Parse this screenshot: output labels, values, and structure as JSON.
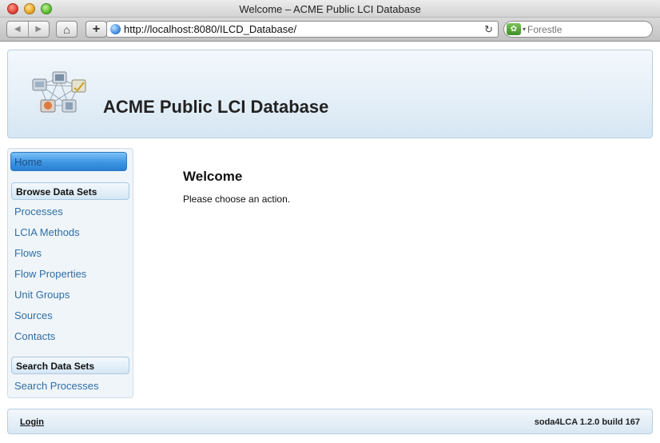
{
  "window": {
    "title": "Welcome – ACME Public LCI Database"
  },
  "toolbar": {
    "back_icon": "◀",
    "forward_icon": "▶",
    "home_icon": "⌂",
    "add_icon": "+",
    "url": "http://localhost:8080/ILCD_Database/",
    "reload_icon": "↻",
    "search_placeholder": "Forestle"
  },
  "header": {
    "site_title": "ACME Public LCI Database"
  },
  "sidebar": {
    "home": "Home",
    "browse_header": "Browse Data Sets",
    "browse_items": [
      "Processes",
      "LCIA Methods",
      "Flows",
      "Flow Properties",
      "Unit Groups",
      "Sources",
      "Contacts"
    ],
    "search_header": "Search Data Sets",
    "search_items": [
      "Search Processes"
    ]
  },
  "main": {
    "title": "Welcome",
    "text": "Please choose an action."
  },
  "footer": {
    "login": "Login",
    "version": "soda4LCA 1.2.0 build 167"
  },
  "colors": {
    "accent": "#3d95e2",
    "link": "#2f6ea6",
    "header_bg": "#e8f1f8"
  }
}
